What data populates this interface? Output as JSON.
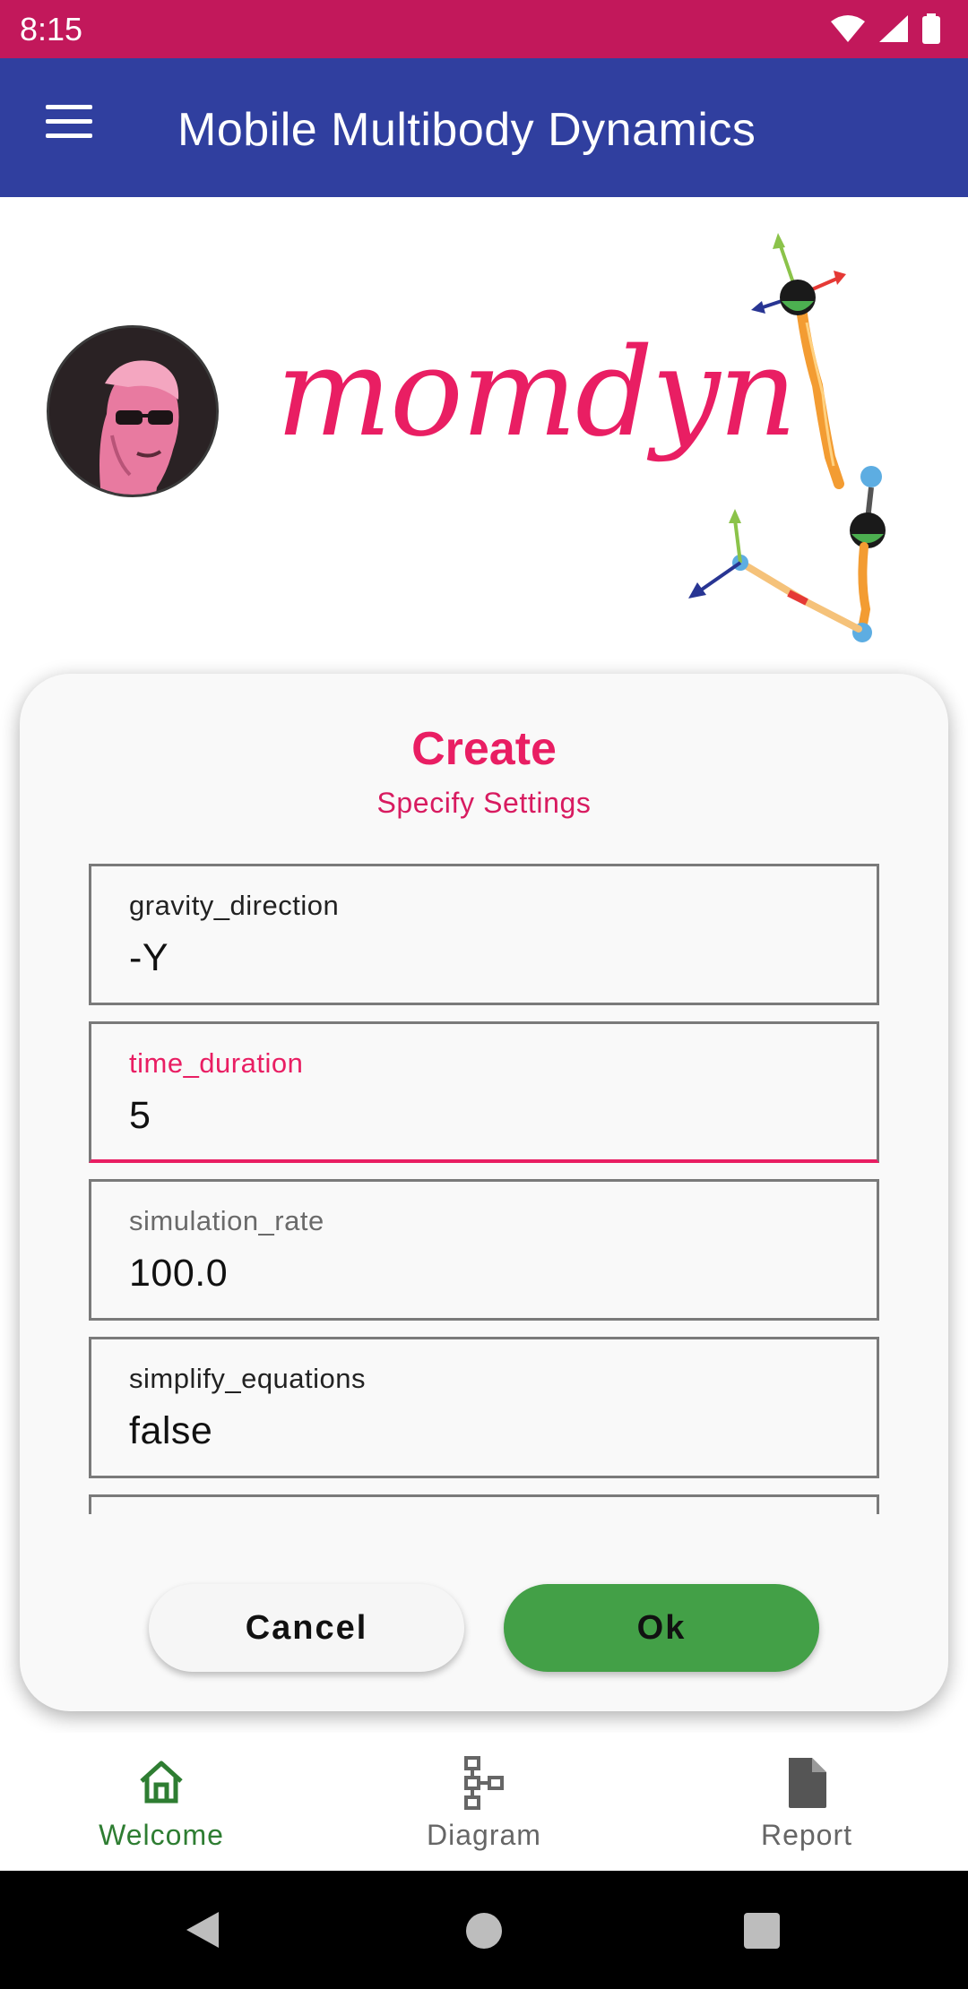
{
  "status_bar": {
    "time": "8:15"
  },
  "app_bar": {
    "title": "Mobile Multibody Dynamics"
  },
  "hero": {
    "logo_text": "momdyn"
  },
  "dialog": {
    "title": "Create",
    "subtitle": "Specify Settings",
    "fields": [
      {
        "label": "gravity_direction",
        "value": "-Y"
      },
      {
        "label": "time_duration",
        "value": "5"
      },
      {
        "label": "simulation_rate",
        "value": "100.0"
      },
      {
        "label": "simplify_equations",
        "value": "false"
      }
    ],
    "cancel_label": "Cancel",
    "ok_label": "Ok"
  },
  "bottom_nav": {
    "items": [
      {
        "label": "Welcome",
        "icon": "home-icon",
        "active": true
      },
      {
        "label": "Diagram",
        "icon": "diagram-icon",
        "active": false
      },
      {
        "label": "Report",
        "icon": "document-icon",
        "active": false
      }
    ]
  },
  "colors": {
    "status_bar": "#c2185b",
    "app_bar": "#303f9f",
    "accent": "#e91e63",
    "ok_button": "#43a047",
    "active_nav": "#2e7d32"
  }
}
